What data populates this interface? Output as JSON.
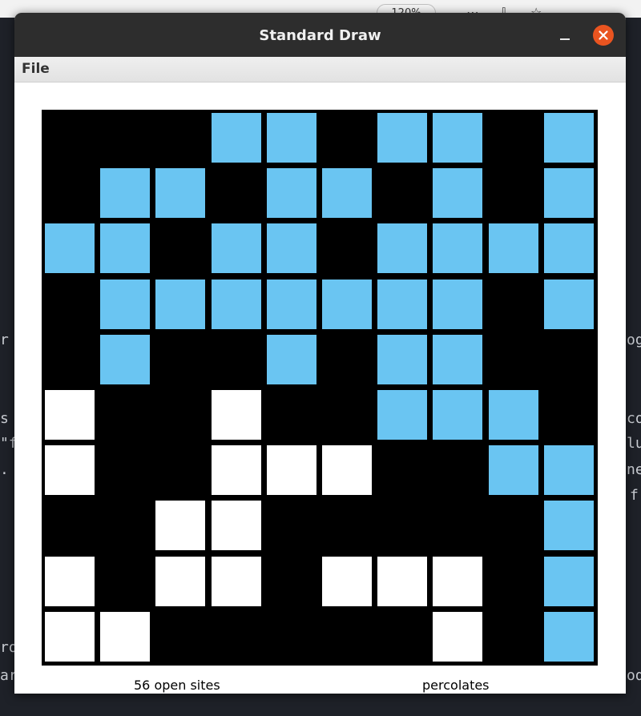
{
  "background": {
    "zoom": "120%",
    "code_fragments": [
      {
        "id": "left-r",
        "text": "r"
      },
      {
        "id": "left-s",
        "text": "s"
      },
      {
        "id": "left-quote",
        "text": "\"f"
      },
      {
        "id": "left-dot",
        "text": "."
      },
      {
        "id": "left-ro",
        "text": "ro"
      },
      {
        "id": "left-ar",
        "text": "ar"
      },
      {
        "id": "right-og",
        "text": "og"
      },
      {
        "id": "right-co",
        "text": "co"
      },
      {
        "id": "right-lu",
        "text": "lu"
      },
      {
        "id": "right-ne",
        "text": "ne"
      },
      {
        "id": "right-f",
        "text": "f"
      },
      {
        "id": "right-od",
        "text": "od"
      }
    ]
  },
  "window": {
    "title": "Standard Draw",
    "menu": [
      "File"
    ]
  },
  "percolation": {
    "n": 10,
    "colors": {
      "blocked": "#000000",
      "open": "#ffffff",
      "full": "#6ac5f2"
    },
    "legend": {
      "B": "blocked",
      "O": "open",
      "F": "full"
    },
    "rows": [
      "BBBFFBFFBF",
      "BFFBFFBFBF",
      "FFBFFBFFFF",
      "BFFFFFFFBF",
      "BFBBFBFFBB",
      "OBBOBBFFFB",
      "OBBOOOBBFF",
      "BBOOBBBBBF",
      "OBOOBOOOBF",
      "OOBBBBBOBF"
    ],
    "open_sites_label": "56 open sites",
    "status_label": "percolates"
  }
}
